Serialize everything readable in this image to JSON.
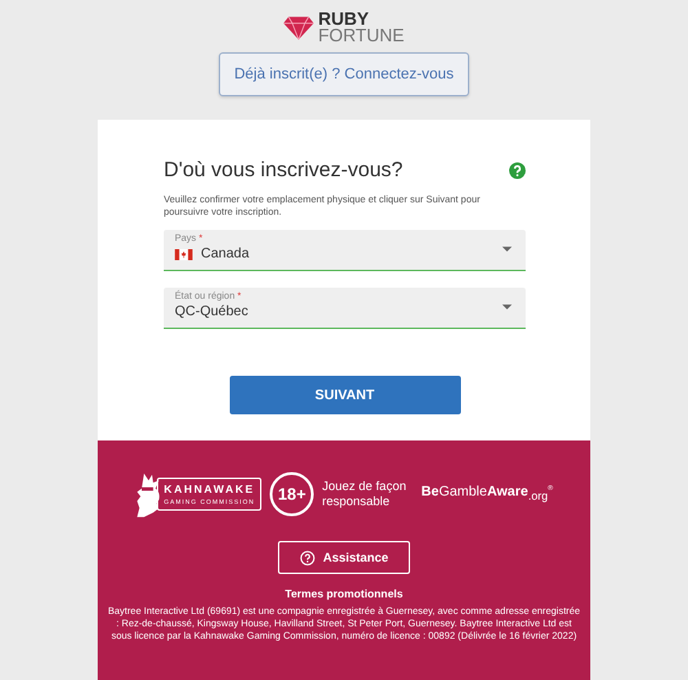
{
  "logo": {
    "line1": "RUBY",
    "line2": "FORTUNE"
  },
  "login_button": "Déjà inscrit(e) ? Connectez-vous",
  "form": {
    "title": "D'où vous inscrivez-vous?",
    "description": "Veuillez confirmer votre emplacement physique et cliquer sur Suivant pour poursuivre votre inscription.",
    "fields": [
      {
        "kind": "country",
        "label": "Pays",
        "required_mark": "*",
        "value": "Canada"
      },
      {
        "kind": "plain",
        "label": "État ou région",
        "required_mark": "*",
        "value": "QC-Québec"
      }
    ],
    "submit": "SUIVANT"
  },
  "footer": {
    "kahnawake": {
      "name": "KAHNAWAKE",
      "sub": "GAMING COMMISSION"
    },
    "age": "18+",
    "age_text": "Jouez de façon responsable",
    "gamble_aware": "**Be**Gamble**Aware**$_{.org}$",
    "gamble_mark": "®",
    "assistance": "Assistance",
    "promo_title": "Termes promotionnels",
    "legal": "Baytree Interactive Ltd (69691) est une compagnie enregistrée à Guernesey, avec comme adresse enregistrée : Rez-de-chaussé, Kingsway House, Havilland Street, St Peter Port, Guernesey. Baytree Interactive Ltd est sous licence par la Kahnawake Gaming Commission, numéro de licence : 00892 (Délivrée le 16 février 2022)"
  }
}
